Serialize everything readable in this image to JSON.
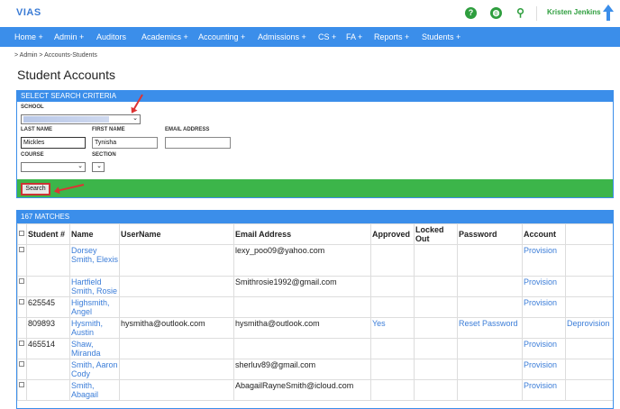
{
  "app": {
    "logo": "VIAS",
    "user_name": "Kristen Jenkins",
    "icons": [
      "help-icon",
      "globe-icon",
      "search-icon",
      "upload-icon"
    ],
    "accent_green": "#2e9e3e",
    "accent_blue": "#3b8eea"
  },
  "nav": {
    "items": [
      "Home +",
      "Admin +",
      "Auditors",
      "Academics +",
      "Accounting +",
      "Admissions +",
      "CS +",
      "FA +",
      "Reports +",
      "Students +"
    ]
  },
  "breadcrumb": "> Admin  > Accounts-Students",
  "page_title": "Student Accounts",
  "criteria": {
    "header": "SELECT SEARCH CRITERIA",
    "school_label": "SCHOOL",
    "school_value": "",
    "last_name_label": "LAST NAME",
    "last_name_value": "Mickles",
    "first_name_label": "FIRST NAME",
    "first_name_value": "Tynisha",
    "email_label": "EMAIL ADDRESS",
    "email_value": "",
    "course_label": "COURSE",
    "course_value": "",
    "section_label": "SECTION",
    "section_value": "",
    "search_label": "Search"
  },
  "results": {
    "header": "167 MATCHES",
    "columns": {
      "student_no": "Student #",
      "name": "Name",
      "username": "UserName",
      "email": "Email Address",
      "approved": "Approved",
      "locked": "Locked Out",
      "password": "Password",
      "account": "Account"
    },
    "rows": [
      {
        "checkbox": true,
        "student_no": "",
        "name": "Dorsey Smith, Elexis",
        "username": "",
        "email": "lexy_poo09@yahoo.com",
        "approved": "",
        "locked": "",
        "password": "",
        "account": "Provision",
        "extra": ""
      },
      {
        "checkbox": true,
        "student_no": "",
        "name": "Hartfield Smith, Rosie",
        "username": "",
        "email": "Smithrosie1992@gmail.com",
        "approved": "",
        "locked": "",
        "password": "",
        "account": "Provision",
        "extra": ""
      },
      {
        "checkbox": true,
        "student_no": "625545",
        "name": "Highsmith, Angel",
        "username": "",
        "email": "",
        "approved": "",
        "locked": "",
        "password": "",
        "account": "Provision",
        "extra": ""
      },
      {
        "checkbox": false,
        "student_no": "809893",
        "name": "Hysmith, Austin",
        "username": "hysmitha@outlook.com",
        "email": "hysmitha@outlook.com",
        "approved": "Yes",
        "locked": "",
        "password": "Reset Password",
        "account": "",
        "extra": "Deprovision"
      },
      {
        "checkbox": true,
        "student_no": "465514",
        "name": "Shaw, Miranda",
        "username": "",
        "email": "",
        "approved": "",
        "locked": "",
        "password": "",
        "account": "Provision",
        "extra": ""
      },
      {
        "checkbox": true,
        "student_no": "",
        "name": "Smith, Aaron Cody",
        "username": "",
        "email": "sherluv89@gmail.com",
        "approved": "",
        "locked": "",
        "password": "",
        "account": "Provision",
        "extra": ""
      },
      {
        "checkbox": true,
        "student_no": "",
        "name": "Smith, Abagail",
        "username": "",
        "email": "AbagailRayneSmith@icloud.com",
        "approved": "",
        "locked": "",
        "password": "",
        "account": "Provision",
        "extra": ""
      }
    ]
  }
}
